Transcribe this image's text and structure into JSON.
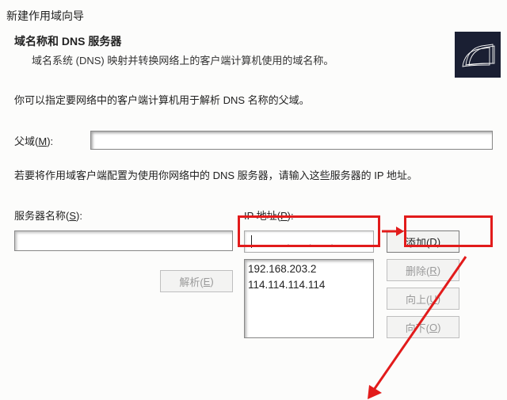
{
  "window_title": "新建作用域向导",
  "header": {
    "title": "域名称和 DNS 服务器",
    "description": "域名系统 (DNS) 映射并转换网络上的客户端计算机使用的域名称。"
  },
  "intro_text": "你可以指定要网络中的客户端计算机用于解析 DNS 名称的父域。",
  "parent_domain": {
    "label_prefix": "父域(",
    "label_hotkey": "M",
    "label_suffix": "):",
    "value": ""
  },
  "hint_text": "若要将作用域客户端配置为使用你网络中的 DNS 服务器，请输入这些服务器的 IP 地址。",
  "server_name": {
    "label_prefix": "服务器名称(",
    "label_hotkey": "S",
    "label_suffix": "):",
    "value": ""
  },
  "resolve_btn": {
    "prefix": "解析(",
    "hotkey": "E",
    "suffix": ")"
  },
  "ip_section": {
    "label_prefix": "IP 地址(",
    "label_hotkey": "P",
    "label_suffix": "):",
    "input_value": ""
  },
  "ip_list": [
    "192.168.203.2",
    "114.114.114.114"
  ],
  "buttons": {
    "add": {
      "prefix": "添加(",
      "hotkey": "D",
      "suffix": ")"
    },
    "remove": {
      "prefix": "删除(",
      "hotkey": "R",
      "suffix": ")"
    },
    "up": {
      "prefix": "向上(",
      "hotkey": "U",
      "suffix": ")"
    },
    "down": {
      "prefix": "向下(",
      "hotkey": "O",
      "suffix": ")"
    }
  },
  "colors": {
    "highlight": "#e21b1b"
  }
}
